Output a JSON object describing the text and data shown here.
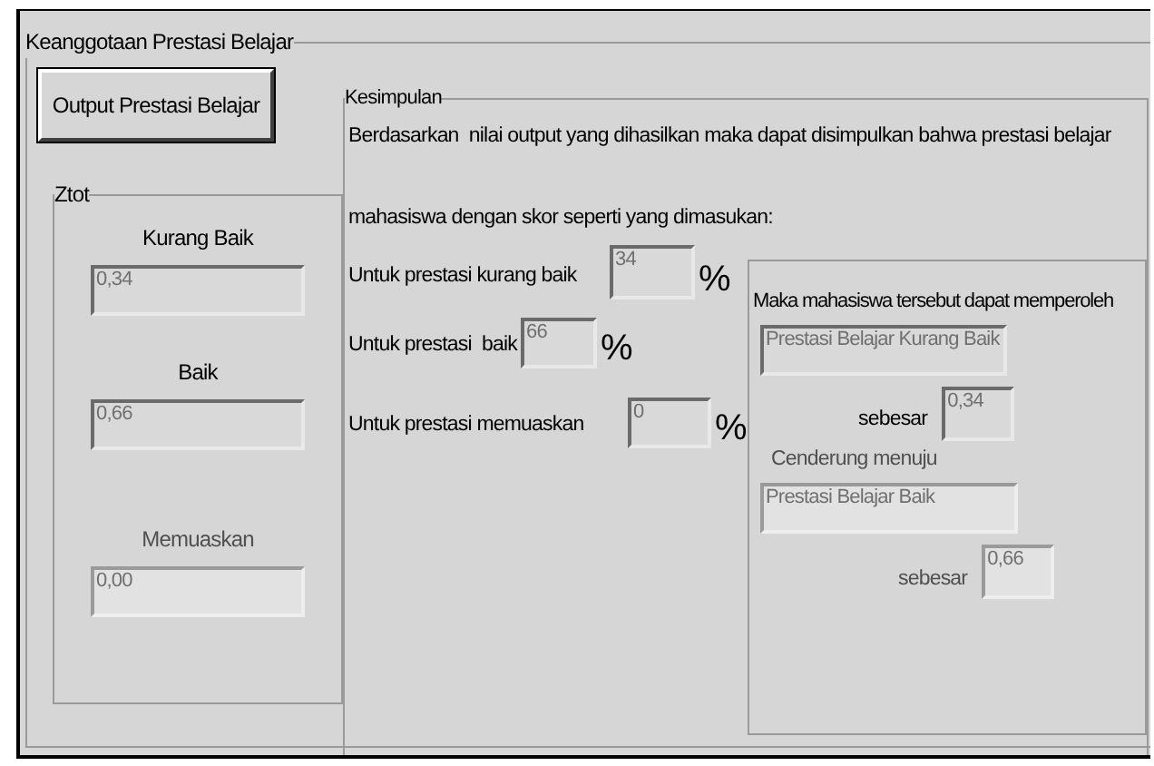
{
  "group_title": "Keanggotaan Prestasi Belajar",
  "output_button": "Output Prestasi Belajar",
  "ztot": {
    "title": "Ztot",
    "items": [
      {
        "label": "Kurang Baik",
        "value": "0,34",
        "faded": false
      },
      {
        "label": "Baik",
        "value": "0,66",
        "faded": false
      },
      {
        "label": "Memuaskan",
        "value": "0,00",
        "faded": true
      }
    ]
  },
  "kesimpulan": {
    "title": "Kesimpulan",
    "lines": [
      "Berdasarkan  nilai output yang dihasilkan maka dapat disimpulkan bahwa prestasi belajar",
      "mahasiswa dengan skor seperti yang dimasukan:"
    ],
    "rows": [
      {
        "label": "Untuk prestasi kurang baik",
        "value": "34",
        "unit": "%"
      },
      {
        "label": "Untuk prestasi  baik",
        "value": "66",
        "unit": "%"
      },
      {
        "label": "Untuk prestasi memuaskan",
        "value": "0",
        "unit": "%"
      }
    ],
    "result": {
      "heading": "Maka mahasiswa tersebut dapat memperoleh",
      "primary": {
        "value": "Prestasi Belajar Kurang Baik",
        "amount_label": "sebesar",
        "amount": "0,34",
        "faded": false
      },
      "tendency": {
        "heading": "Cenderung menuju",
        "value": "Prestasi Belajar Baik",
        "amount_label": "sebesar",
        "amount": "0,66",
        "faded": true
      }
    }
  }
}
